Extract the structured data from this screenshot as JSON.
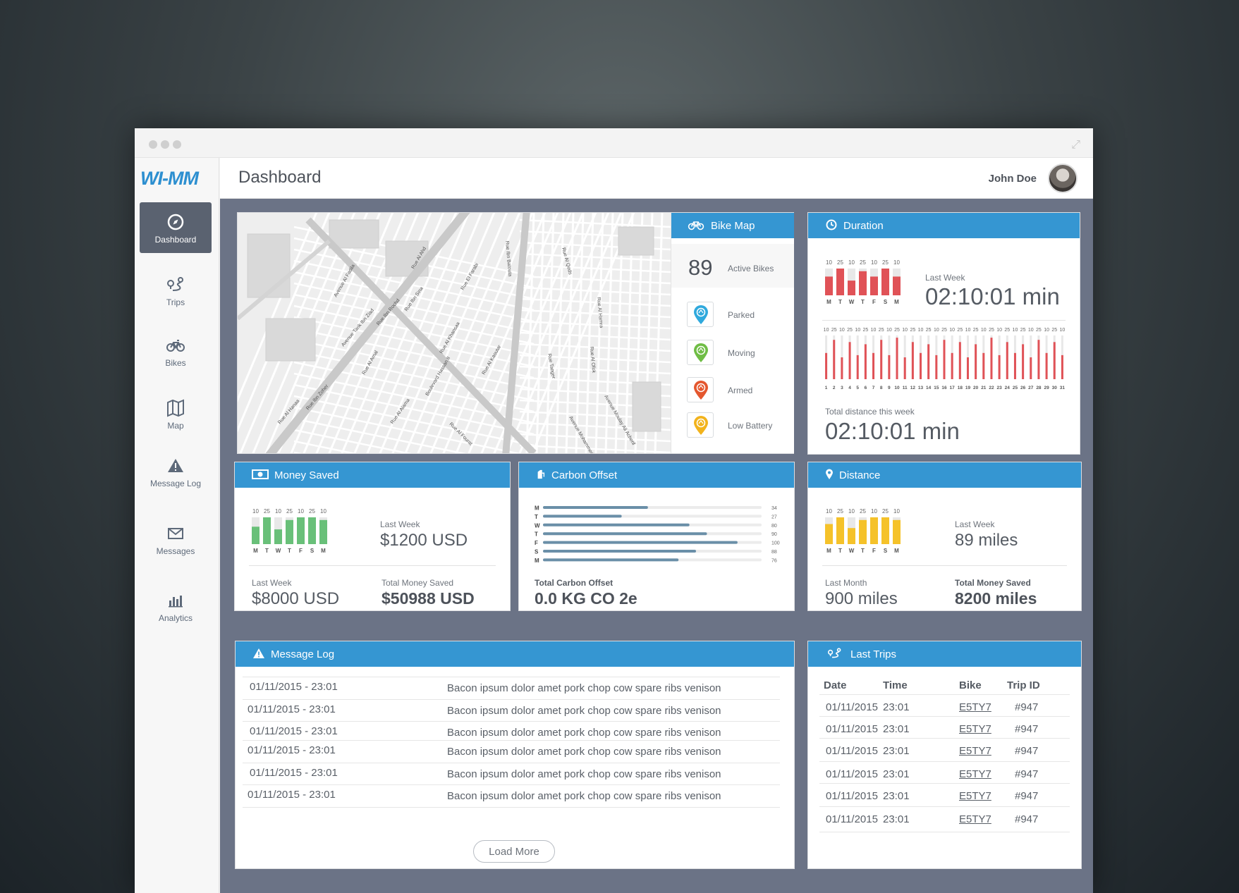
{
  "app": {
    "logo": "WI-MM",
    "page_title": "Dashboard",
    "user_name": "John Doe"
  },
  "colors": {
    "accent": "#3596d2",
    "red": "#e05257",
    "green": "#69c079",
    "yellow": "#f5c22a",
    "steel": "#6a8fa8",
    "parked": "#2fa9dd",
    "moving": "#6fbd45",
    "armed": "#e4572e",
    "low_battery": "#f2b31c"
  },
  "sidebar": {
    "items": [
      {
        "label": "Dashboard",
        "icon": "compass-icon",
        "active": true
      },
      {
        "label": "Trips",
        "icon": "route-icon"
      },
      {
        "label": "Bikes",
        "icon": "bike-icon"
      },
      {
        "label": "Map",
        "icon": "map-icon"
      },
      {
        "label": "Message Log",
        "icon": "warning-icon"
      },
      {
        "label": "Messages",
        "icon": "envelope-icon"
      },
      {
        "label": "Analytics",
        "icon": "bar-chart-icon"
      }
    ]
  },
  "bike_map": {
    "title": "Bike Map",
    "active_count": "89",
    "active_label": "Active Bikes",
    "legend": [
      {
        "label": "Parked",
        "color": "#2fa9dd"
      },
      {
        "label": "Moving",
        "color": "#6fbd45"
      },
      {
        "label": "Armed",
        "color": "#e4572e"
      },
      {
        "label": "Low Battery",
        "color": "#f2b31c"
      }
    ],
    "street_labels": [
      "Avenue Tarik Ibn Ziad",
      "Rue Al Ahd",
      "Rue El Farabi",
      "Boulevard Hassan II",
      "Rue Al Amal",
      "Rue Ibn Rochd",
      "Rue Al Alama",
      "Avenue Moulay Ali Acherif",
      "Rue Ibn Zoher",
      "Rue Al Khansaa",
      "Rue Al Kaoutar",
      "Rue Al Qods",
      "Rue Al Hamra",
      "Rue Al Hanaa",
      "Rue Ibn Sina",
      "Avenue Mohammed V",
      "Rue Al Fourat",
      "Avenue Al Fadila",
      "Rue Ibn Batouta",
      "Rue Tanger",
      "Rue Al Ofok"
    ]
  },
  "duration": {
    "title": "Duration",
    "week_days": [
      "M",
      "T",
      "W",
      "T",
      "F",
      "S",
      "M"
    ],
    "week_values": [
      10,
      25,
      10,
      25,
      10,
      25,
      10
    ],
    "week_fill": [
      0.7,
      1.0,
      0.55,
      0.9,
      0.7,
      1.0,
      0.7
    ],
    "last_week_label": "Last Week",
    "last_week_value": "02:10:01 min",
    "month_values": [
      10,
      25,
      10,
      25,
      10,
      25,
      10,
      25,
      10,
      25,
      10,
      25,
      10,
      25,
      10,
      25,
      10,
      25,
      10,
      25,
      10,
      25,
      10,
      25,
      10,
      25,
      10,
      25,
      10,
      25,
      10
    ],
    "month_days": [
      "1",
      "2",
      "3",
      "4",
      "5",
      "6",
      "7",
      "8",
      "9",
      "10",
      "11",
      "12",
      "13",
      "14",
      "15",
      "16",
      "17",
      "18",
      "19",
      "20",
      "21",
      "22",
      "23",
      "24",
      "25",
      "26",
      "27",
      "28",
      "29",
      "30",
      "31"
    ],
    "month_fill": [
      0.6,
      0.9,
      0.5,
      0.85,
      0.55,
      0.8,
      0.6,
      0.9,
      0.55,
      0.95,
      0.5,
      0.85,
      0.6,
      0.8,
      0.55,
      0.9,
      0.6,
      0.85,
      0.5,
      0.8,
      0.6,
      0.95,
      0.55,
      0.85,
      0.6,
      0.8,
      0.5,
      0.9,
      0.6,
      0.85,
      0.55
    ],
    "total_label": "Total distance this week",
    "total_value": "02:10:01 min"
  },
  "money_saved": {
    "title": "Money Saved",
    "week_days": [
      "M",
      "T",
      "W",
      "T",
      "F",
      "S",
      "M"
    ],
    "week_values": [
      10,
      25,
      10,
      25,
      10,
      25,
      10
    ],
    "week_fill": [
      0.65,
      1.0,
      0.55,
      0.9,
      1.0,
      1.0,
      0.9
    ],
    "last_week_label": "Last Week",
    "last_week_value": "$1200 USD",
    "prev_label": "Last Week",
    "prev_value": "$8000 USD",
    "total_label": "Total Money Saved",
    "total_value": "$50988 USD"
  },
  "carbon_offset": {
    "title": "Carbon Offset",
    "days": [
      "M",
      "T",
      "W",
      "T",
      "F",
      "S",
      "M"
    ],
    "values": [
      34,
      27,
      80,
      90,
      100,
      88,
      76
    ],
    "fill": [
      0.48,
      0.36,
      0.67,
      0.75,
      0.89,
      0.7,
      0.62
    ],
    "total_label": "Total Carbon Offset",
    "total_value": "0.0 KG CO 2e"
  },
  "distance": {
    "title": "Distance",
    "week_days": [
      "M",
      "T",
      "W",
      "T",
      "F",
      "S",
      "M"
    ],
    "week_values": [
      10,
      25,
      10,
      25,
      10,
      25,
      10
    ],
    "week_fill": [
      0.75,
      1.0,
      0.6,
      0.9,
      1.0,
      1.0,
      0.9
    ],
    "last_week_label": "Last Week",
    "last_week_value": "89 miles",
    "prev_label": "Last Month",
    "prev_value": "900 miles",
    "total_label": "Total Money Saved",
    "total_value": "8200 miles"
  },
  "message_log": {
    "title": "Message Log",
    "rows": [
      {
        "date": "01/11/2015 - 23:01",
        "message": "Bacon ipsum dolor amet pork chop cow spare ribs venison"
      },
      {
        "date": "01/11/2015 - 23:01",
        "message": "Bacon ipsum dolor amet pork chop cow spare ribs venison"
      },
      {
        "date": "01/11/2015 - 23:01",
        "message": "Bacon ipsum dolor amet pork chop cow spare ribs venison"
      },
      {
        "date": "01/11/2015 - 23:01",
        "message": "Bacon ipsum dolor amet pork chop cow spare ribs venison"
      },
      {
        "date": "01/11/2015 - 23:01",
        "message": "Bacon ipsum dolor amet pork chop cow spare ribs venison"
      },
      {
        "date": "01/11/2015 - 23:01",
        "message": "Bacon ipsum dolor amet pork chop cow spare ribs venison"
      }
    ],
    "load_more": "Load More"
  },
  "last_trips": {
    "title": "Last Trips",
    "headers": [
      "Date",
      "Time",
      "Bike",
      "Trip ID"
    ],
    "rows": [
      {
        "date": "01/11/2015",
        "time": "23:01",
        "bike": "E5TY7",
        "trip_id": "#947"
      },
      {
        "date": "01/11/2015",
        "time": "23:01",
        "bike": "E5TY7",
        "trip_id": "#947"
      },
      {
        "date": "01/11/2015",
        "time": "23:01",
        "bike": "E5TY7",
        "trip_id": "#947"
      },
      {
        "date": "01/11/2015",
        "time": "23:01",
        "bike": "E5TY7",
        "trip_id": "#947"
      },
      {
        "date": "01/11/2015",
        "time": "23:01",
        "bike": "E5TY7",
        "trip_id": "#947"
      },
      {
        "date": "01/11/2015",
        "time": "23:01",
        "bike": "E5TY7",
        "trip_id": "#947"
      }
    ]
  }
}
